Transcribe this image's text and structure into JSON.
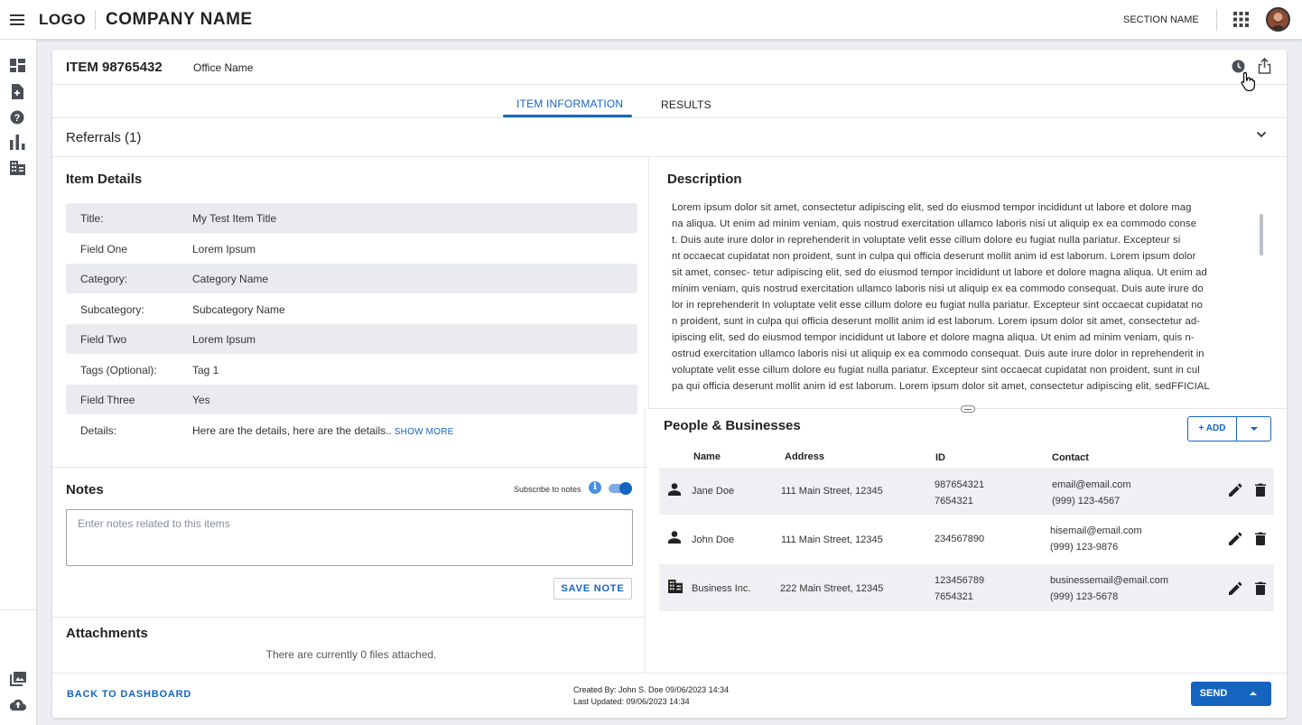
{
  "app": {
    "logo": "LOGO",
    "company": "COMPANY NAME",
    "section": "SECTION NAME"
  },
  "rail": {
    "icons": [
      "dashboard-icon",
      "add-document-icon",
      "help-icon",
      "bar-chart-icon",
      "building-icon",
      "photo-library-icon",
      "cloud-upload-icon"
    ]
  },
  "item": {
    "id": "ITEM 98765432",
    "office": "Office Name"
  },
  "tabs": [
    {
      "label": "ITEM INFORMATION",
      "active": true
    },
    {
      "label": "RESULTS",
      "active": false
    }
  ],
  "referrals": {
    "label": "Referrals (1)"
  },
  "details": {
    "title": "Item Details",
    "rows": [
      {
        "label": "Title:",
        "value": "My Test Item Title"
      },
      {
        "label": "Field One",
        "value": "Lorem Ipsum"
      },
      {
        "label": "Category:",
        "value": "Category Name"
      },
      {
        "label": "Subcategory:",
        "value": "Subcategory Name"
      },
      {
        "label": "Field Two",
        "value": "Lorem Ipsum"
      },
      {
        "label": "Tags (Optional):",
        "value": "Tag 1"
      },
      {
        "label": "Field Three",
        "value": "Yes"
      },
      {
        "label": "Details:",
        "value": "Here are the details, here are the details.."
      }
    ],
    "show_more": "SHOW MORE"
  },
  "description": {
    "title": "Description",
    "lines": [
      "Lorem ipsum dolor sit amet, consectetur adipiscing elit, sed do eiusmod tempor incididunt ut labore et dolore mag",
      "na aliqua. Ut enim ad minim veniam, quis nostrud exercitation ullamco laboris nisi ut aliquip ex ea commodo conse",
      "t. Duis aute irure dolor in reprehenderit in voluptate velit esse cillum dolore eu fugiat nulla pariatur. Excepteur si",
      "nt occaecat cupidatat non proident, sunt in culpa qui officia deserunt mollit anim id est laborum. Lorem ipsum dolor",
      "sit amet, consec- tetur adipiscing elit, sed do eiusmod tempor incididunt ut labore et dolore magna aliqua. Ut enim ad",
      "minim veniam, quis nostrud exercitation ullamco laboris nisi ut aliquip ex ea commodo consequat. Duis aute irure do",
      "lor in reprehenderit In voluptate velit esse cillum dolore eu fugiat nulla pariatur. Excepteur sint occaecat cupidatat no",
      "n proident, sunt in culpa qui officia deserunt mollit anim id est laborum. Lorem ipsum dolor sit amet, consectetur ad-",
      "ipiscing elit, sed do eiusmod tempor incididunt ut labore et dolore magna aliqua. Ut enim ad minim veniam, quis n-",
      "ostrud exercitation ullamco laboris nisi ut aliquip ex ea commodo consequat. Duis aute irure dolor in reprehenderit in",
      "voluptate velit esse cillum dolore eu fugiat nulla pariatur. Excepteur sint occaecat cupidatat non proident, sunt in cul",
      "pa qui officia deserunt mollit anim id est laborum. Lorem ipsum dolor sit amet, consectetur adipiscing elit, sedFFICIAL"
    ]
  },
  "notes": {
    "title": "Notes",
    "subscribe_label": "Subscribe to notes",
    "info": "i",
    "subscribed": true,
    "placeholder": "Enter notes related to this items",
    "save_label": "SAVE NOTE"
  },
  "attachments": {
    "title": "Attachments",
    "empty": "There are currently 0 files attached."
  },
  "people": {
    "title": "People & Businesses",
    "add_label": "+ ADD",
    "columns": [
      "Name",
      "Address",
      "ID",
      "Contact"
    ],
    "rows": [
      {
        "type": "person",
        "name": "Jane Doe",
        "address": "111 Main Street, 12345",
        "id1": "987654321",
        "id2": "7654321",
        "email": "email@email.com",
        "phone": "(999) 123-4567"
      },
      {
        "type": "person",
        "name": "John Doe",
        "address": "111 Main Street, 12345",
        "id1": "234567890",
        "id2": "",
        "email": "hisemail@email.com",
        "phone": "(999) 123-9876"
      },
      {
        "type": "business",
        "name": "Business Inc.",
        "address": "222 Main Street, 12345",
        "id1": "123456789",
        "id2": "7654321",
        "email": "businessemail@email.com",
        "phone": "(999) 123-5678"
      }
    ]
  },
  "footer": {
    "back_label": "BACK TO DASHBOARD",
    "created": "Created By: John S. Doe 09/06/2023 14:34",
    "updated": "Last Updated: 09/06/2023 14:34",
    "send_label": "SEND"
  },
  "colors": {
    "accent": "#1565c0",
    "shaded_row": "#e9ebee",
    "background": "#eceef1"
  }
}
